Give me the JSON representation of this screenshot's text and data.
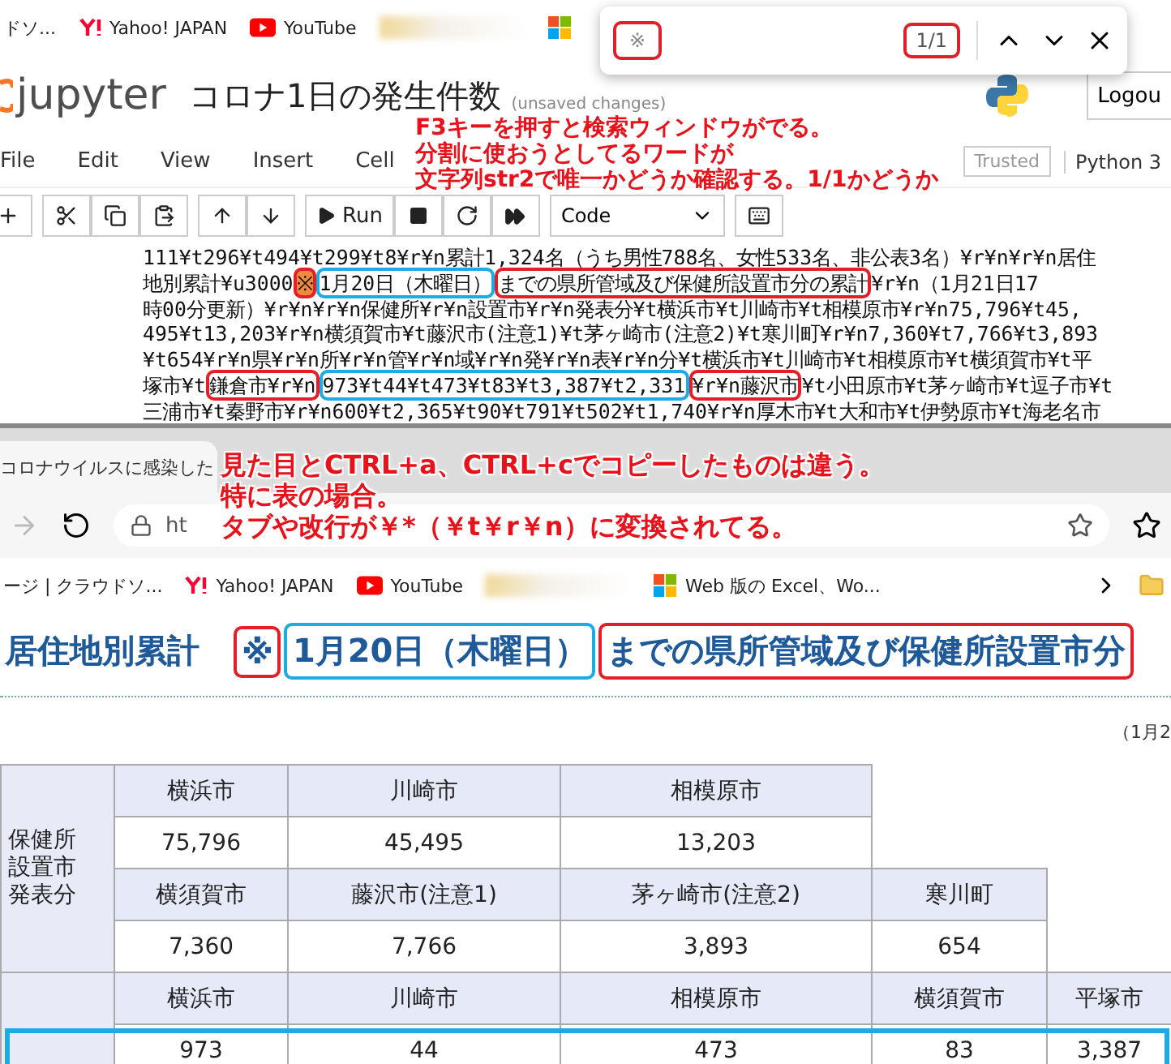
{
  "top_browser": {
    "bookmarks": [
      {
        "kind": "text",
        "label": "ドソ..."
      },
      {
        "kind": "yahoo",
        "label": "Yahoo! JAPAN"
      },
      {
        "kind": "youtube",
        "label": "YouTube"
      },
      {
        "kind": "blurred"
      },
      {
        "kind": "windows"
      }
    ]
  },
  "find_bar": {
    "query": {
      "text": "※",
      "kind": "red_box"
    },
    "count": {
      "text": "1/1",
      "kind": "red_box"
    }
  },
  "notebook": {
    "logo": "jupyter",
    "title": "コロナ1日の発生件数",
    "status": "(unsaved changes)",
    "logout": "Logou",
    "menu": [
      "File",
      "Edit",
      "View",
      "Insert",
      "Cell"
    ],
    "trusted": "Trusted",
    "kernel": "Python 3",
    "run": "Run",
    "cell_type": "Code",
    "output_lines": [
      [
        {
          "text": "111¥t296¥t494¥t299¥t8¥r¥n累計1,324名（うち男性788名、女性533名、非公表3名）¥r¥n¥r¥n居住",
          "kind": "plain"
        }
      ],
      [
        {
          "text": "地別累計¥u3000",
          "kind": "plain"
        },
        {
          "text": "※",
          "kind": "red_box",
          "hit": true
        },
        {
          "text": "1月20日（木曜日）",
          "kind": "blue_box"
        },
        {
          "text": "までの県所管域及び保健所設置市分の累計",
          "kind": "red_box"
        },
        {
          "text": "¥r¥n（1月21日17",
          "kind": "plain"
        }
      ],
      [
        {
          "text": "時00分更新）¥r¥n¥r¥n保健所¥r¥n設置市¥r¥n発表分¥t横浜市¥t川崎市¥t相模原市¥r¥n75,796¥t45,",
          "kind": "plain"
        }
      ],
      [
        {
          "text": "495¥t13,203¥r¥n横須賀市¥t藤沢市(注意1)¥t茅ヶ崎市(注意2)¥t寒川町¥r¥n7,360¥t7,766¥t3,893",
          "kind": "plain"
        }
      ],
      [
        {
          "text": "¥t654¥r¥n県¥r¥n所¥r¥n管¥r¥n域¥r¥n発¥r¥n表¥r¥n分¥t横浜市¥t川崎市¥t相模原市¥t横須賀市¥t平",
          "kind": "plain"
        }
      ],
      [
        {
          "text": "塚市¥t",
          "kind": "plain"
        },
        {
          "text": "鎌倉市¥r¥n",
          "kind": "red_box"
        },
        {
          "text": "973¥t44¥t473¥t83¥t3,387¥t2,331",
          "kind": "blue_box"
        },
        {
          "text": "¥r¥n藤沢市",
          "kind": "red_box"
        },
        {
          "text": "¥t小田原市¥t茅ヶ崎市¥t逗子市¥t",
          "kind": "plain"
        }
      ],
      [
        {
          "text": "三浦市¥t秦野市¥r¥n600¥t2,365¥t90¥t791¥t502¥t1,740¥r¥n厚木市¥t大和市¥t伊勢原市¥t海老名市",
          "kind": "plain"
        }
      ]
    ]
  },
  "annotation_1": [
    "F3キーを押すと検索ウィンドウがでる。",
    "分割に使おうとしてるワードが",
    "文字列str2で唯一かどうか確認する。1/1かどうか"
  ],
  "bottom_browser": {
    "tab_title": "コロナウイルスに感染した",
    "url": "ht",
    "bookmarks": [
      {
        "kind": "text",
        "label": "ージ | クラウドソ..."
      },
      {
        "kind": "yahoo",
        "label": "Yahoo! JAPAN"
      },
      {
        "kind": "youtube",
        "label": "YouTube"
      },
      {
        "kind": "blurred"
      },
      {
        "kind": "windows",
        "label": "Web 版の Excel、Wo..."
      }
    ]
  },
  "annotation_2": [
    "見た目とCTRL+a、CTRL+cでコピーしたものは違う。",
    "特に表の場合。",
    "タブや改行が￥*（￥t￥r￥n）に変換されてる。"
  ],
  "page": {
    "heading": [
      {
        "text": "居住地別累計",
        "kind": "plain"
      },
      {
        "text": "※",
        "kind": "red_box"
      },
      {
        "text": "1月20日（木曜日）",
        "kind": "blue_box"
      },
      {
        "text": "までの県所管域及び保健所設置市分",
        "kind": "red_box"
      }
    ],
    "update_note": "（1月2",
    "table": {
      "groups": [
        {
          "label": [
            "保健所",
            "設置市",
            "発表分"
          ],
          "rows": [
            {
              "kind": "header",
              "cells": [
                "横浜市",
                "川崎市",
                "相模原市"
              ]
            },
            {
              "kind": "value",
              "boxed": false,
              "cells": [
                "75,796",
                "45,495",
                "13,203"
              ]
            },
            {
              "kind": "header",
              "cells": [
                "横須賀市",
                "藤沢市(注意1)",
                "茅ヶ崎市(注意2)",
                "寒川町"
              ]
            },
            {
              "kind": "value",
              "boxed": false,
              "cells": [
                "7,360",
                "7,766",
                "3,893",
                "654"
              ]
            }
          ]
        },
        {
          "rows": [
            {
              "kind": "header",
              "cells": [
                "横浜市",
                "川崎市",
                "相模原市",
                "横須賀市",
                "平塚市"
              ]
            },
            {
              "kind": "value",
              "boxed": true,
              "cells": [
                "973",
                "44",
                "473",
                "83",
                "3,387"
              ]
            }
          ]
        }
      ]
    }
  }
}
